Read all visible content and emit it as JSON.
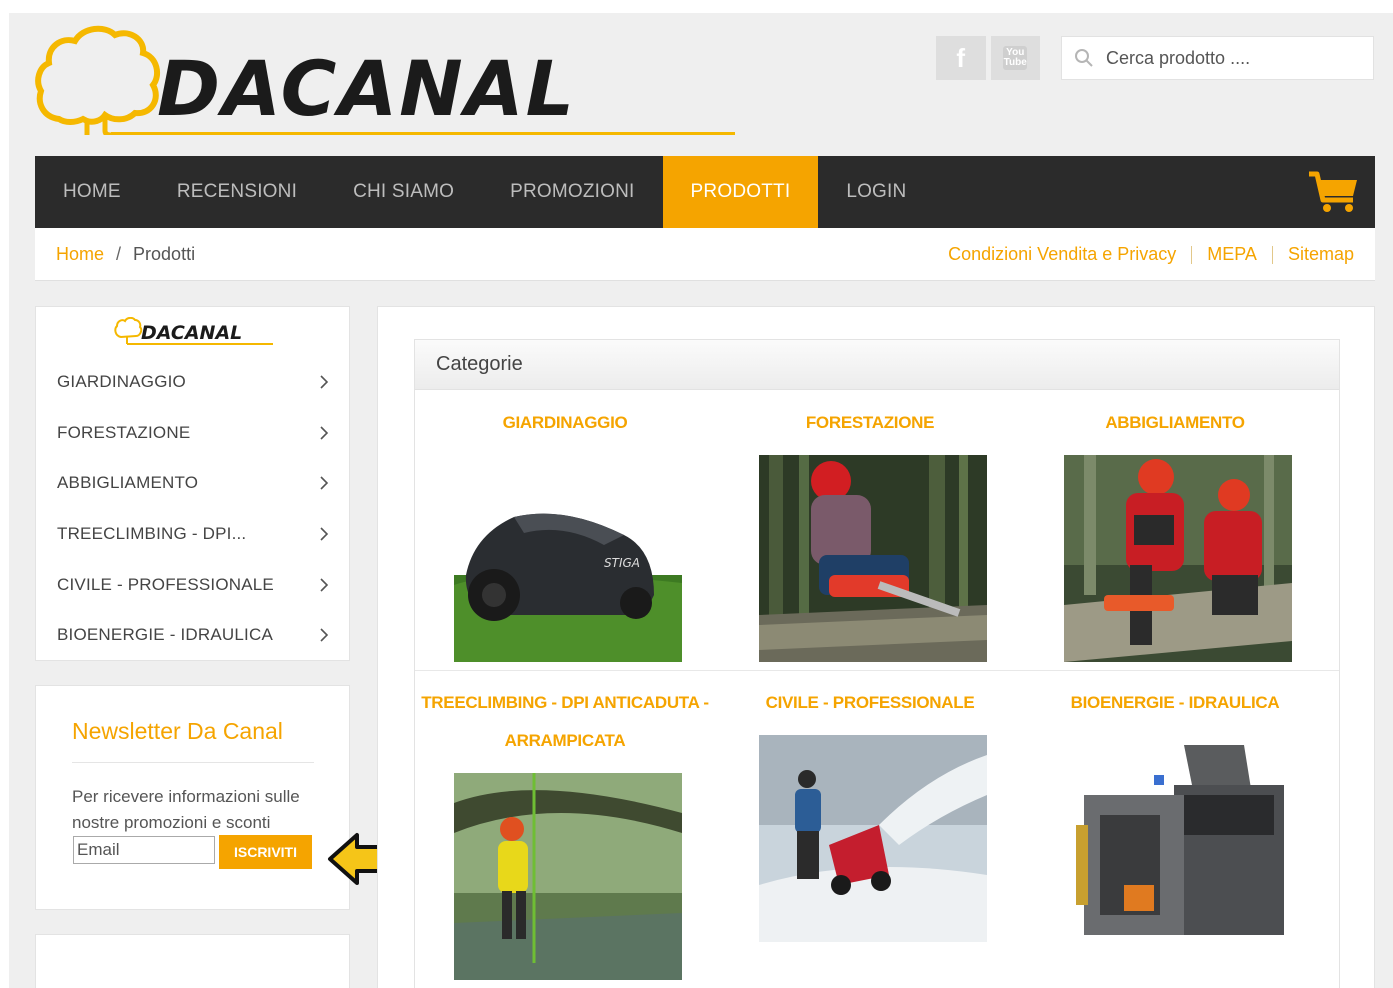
{
  "header": {
    "brand": "DACANAL",
    "search_placeholder": "Cerca prodotto ....",
    "social": [
      {
        "name": "facebook",
        "label": "f"
      },
      {
        "name": "youtube",
        "label": "You Tube"
      }
    ]
  },
  "nav": {
    "items": [
      {
        "label": "HOME",
        "active": false
      },
      {
        "label": "RECENSIONI",
        "active": false
      },
      {
        "label": "CHI SIAMO",
        "active": false
      },
      {
        "label": "PROMOZIONI",
        "active": false
      },
      {
        "label": "PRODOTTI",
        "active": true
      },
      {
        "label": "LOGIN",
        "active": false
      }
    ]
  },
  "breadcrumb": {
    "home": "Home",
    "separator": "/",
    "current": "Prodotti"
  },
  "top_links": [
    "Condizioni Vendita e Privacy",
    "MEPA",
    "Sitemap"
  ],
  "sidebar": {
    "brand": "DACANAL",
    "items": [
      "GIARDINAGGIO",
      "FORESTAZIONE",
      "ABBIGLIAMENTO",
      "TREECLIMBING - DPI...",
      "CIVILE - PROFESSIONALE",
      "BIOENERGIE - IDRAULICA"
    ]
  },
  "newsletter": {
    "title": "Newsletter Da Canal",
    "text": "Per ricevere informazioni sulle nostre promozioni e sconti",
    "email_placeholder": "Email",
    "button": "ISCRIVITI"
  },
  "main": {
    "section_title": "Categorie",
    "categories": [
      {
        "label": "GIARDINAGGIO",
        "label2": ""
      },
      {
        "label": "FORESTAZIONE",
        "label2": ""
      },
      {
        "label": "ABBIGLIAMENTO",
        "label2": ""
      },
      {
        "label": "TREECLIMBING - DPI ANTICADUTA -",
        "label2": "ARRAMPICATA"
      },
      {
        "label": "CIVILE - PROFESSIONALE",
        "label2": ""
      },
      {
        "label": "BIOENERGIE - IDRAULICA",
        "label2": ""
      }
    ]
  },
  "colors": {
    "accent": "#f5a400",
    "nav_bg": "#2b2b2b",
    "page_bg": "#efefef"
  }
}
